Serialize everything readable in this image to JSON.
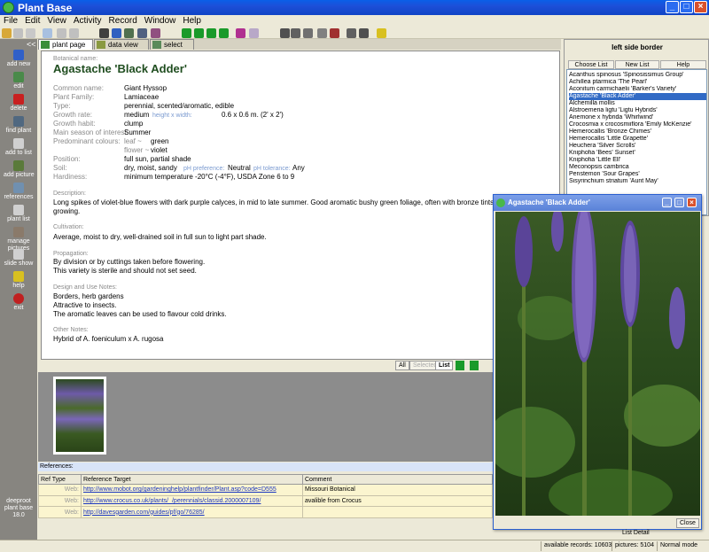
{
  "window": {
    "title": "Plant Base"
  },
  "menu": [
    "File",
    "Edit",
    "View",
    "Activity",
    "Record",
    "Window",
    "Help"
  ],
  "left_buttons": [
    "add new",
    "edit",
    "delete",
    "find plant",
    "add to list",
    "add picture",
    "references",
    "plant list",
    "manage pictures",
    "slide show",
    "help",
    "exit"
  ],
  "left_collapse": "<<",
  "version_text": "deeproot plant base 18.0",
  "tabs": [
    "plant page",
    "data view",
    "select"
  ],
  "plant": {
    "botanical_label": "Botanical name:",
    "botanical_name": "Agastache 'Black Adder'",
    "fields": [
      {
        "label": "Common name:",
        "value": "Giant Hyssop"
      },
      {
        "label": "Plant Family:",
        "value": "Lamiaceae"
      },
      {
        "label": "Type:",
        "value": "perennial, scented/aromatic, edible"
      },
      {
        "label": "Growth rate:",
        "value": "medium"
      },
      {
        "label": "Growth habit:",
        "value": "clump"
      },
      {
        "label": "Main season of interest:",
        "value": "Summer"
      },
      {
        "label": "Predominant colours:",
        "value": ""
      },
      {
        "label": "",
        "value": ""
      },
      {
        "label": "Position:",
        "value": "full sun, partial shade"
      },
      {
        "label": "Soil:",
        "value": "dry, moist, sandy"
      },
      {
        "label": "Hardiness:",
        "value": "minimum temperature -20°C (-4°F), USDA Zone 6 to 9"
      }
    ],
    "size_label": "height x width:",
    "size_value": "0.6 x 0.6 m. (2' x 2')",
    "leaf_label": "leaf ~",
    "leaf_value": "green",
    "flower_label": "flower ~",
    "flower_value": "violet",
    "ph_pref_label": "pH preference:",
    "ph_pref_value": "Neutral",
    "ph_tol_label": "pH tolerance:",
    "ph_tol_value": "Any",
    "sections": [
      {
        "label": "Description:",
        "lines": [
          "Long spikes of violet-blue flowers with dark purple calyces, in mid to late summer. Good aromatic bushy green foliage, often with bronze tints. Easy to",
          "growing."
        ]
      },
      {
        "label": "Cultivation:",
        "lines": [
          "Average, moist to dry, well-drained soil in full sun to light part shade."
        ]
      },
      {
        "label": "Propagation:",
        "lines": [
          "By division or by cuttings taken before flowering.",
          "This variety is sterile and should not set seed."
        ]
      },
      {
        "label": "Design and Use Notes:",
        "lines": [
          "Borders, herb gardens",
          "Attractive to insects.",
          "The aromatic leaves can be used to flavour cold drinks."
        ]
      },
      {
        "label": "Other Notes:",
        "lines": [
          "Hybrid of A. foeniculum x A. rugosa"
        ]
      }
    ]
  },
  "bottom_buttons": [
    "All",
    "Selected",
    "List"
  ],
  "references": {
    "header": "References:",
    "columns": [
      "Ref Type",
      "Reference Target",
      "Comment"
    ],
    "rows": [
      {
        "type": "Web:",
        "target": "http://www.mobot.org/gardeninghelp/plantfinder/Plant.asp?code=D555",
        "comment": "Missouri Botanical"
      },
      {
        "type": "Web:",
        "target": "http://www.crocus.co.uk/plants/_/perennials/classid.2000007109/",
        "comment": "avalible from Crocus"
      },
      {
        "type": "Web:",
        "target": "http://davesgarden.com/guides/pf/go/76285/",
        "comment": ""
      }
    ]
  },
  "right_panel": {
    "title": "left side border",
    "tabs": [
      "Choose List",
      "New List",
      "Help"
    ],
    "items": [
      "Acanthus spinosus 'Spinosissimus Group'",
      "Achillea ptarmica 'The Pearl'",
      "Aconitum carmichaelii 'Barker's Variety'",
      "Agastache 'Black Adder'",
      "Alchemilla mollis",
      "Alstroemeria ligtu 'Ligtu Hybrids'",
      "Anemone x hybrida 'Whirlwind'",
      "Crocosmia x crocosmiiflora 'Emily McKenzie'",
      "Hemerocallis 'Bronze Chimes'",
      "Hemerocallis 'Little Grapette'",
      "Heuchera 'Silver Scrolls'",
      "Kniphofia 'Bees' Sunset'",
      "Kniphofia 'Little Ell'",
      "Meconopsis cambrica",
      "Penstemon 'Sour Grapes'",
      "Sisyrinchium striatum 'Aunt May'"
    ],
    "selected_index": 3
  },
  "image_window": {
    "title": "Agastache 'Black Adder'",
    "close_label": "Close"
  },
  "list_detail": "List Detail",
  "status": {
    "records": "available records: 10603",
    "pictures": "pictures: 5104",
    "mode": "Normal mode"
  },
  "colors": {
    "title_blue": "#1d4fd8",
    "plant_name": "#1f4d1f",
    "selected_row": "#316ac5",
    "panel_grey": "#878580"
  }
}
